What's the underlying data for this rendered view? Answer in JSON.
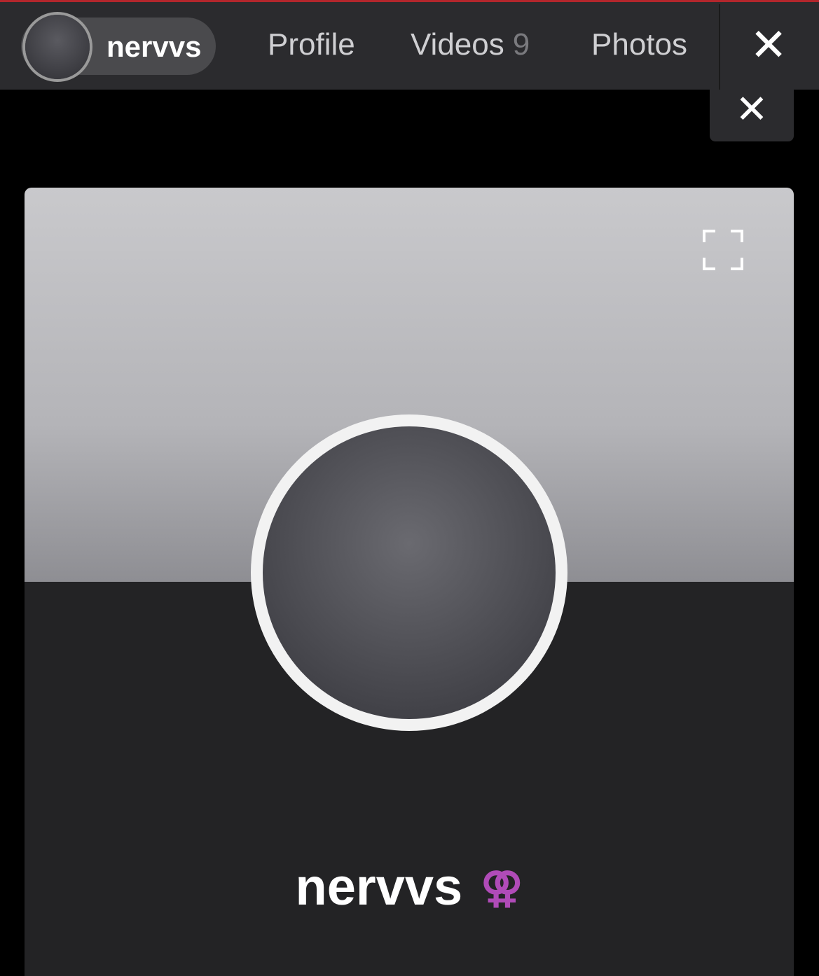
{
  "header": {
    "username": "nervvs",
    "tabs": [
      {
        "label": "Profile",
        "count": ""
      },
      {
        "label": "Videos",
        "count": "9"
      },
      {
        "label": "Photos",
        "count": ""
      }
    ],
    "close_label": "✕"
  },
  "profile": {
    "name": "nervvs",
    "gender_icon": "⚢"
  },
  "icons": {
    "fullscreen": "fullscreen-icon",
    "close": "close-icon",
    "gender": "female-female-icon"
  },
  "colors": {
    "topbar": "#2b2b2e",
    "accent_line": "#b3262c",
    "card": "#232325",
    "gender_icon": "#b04bb8"
  }
}
